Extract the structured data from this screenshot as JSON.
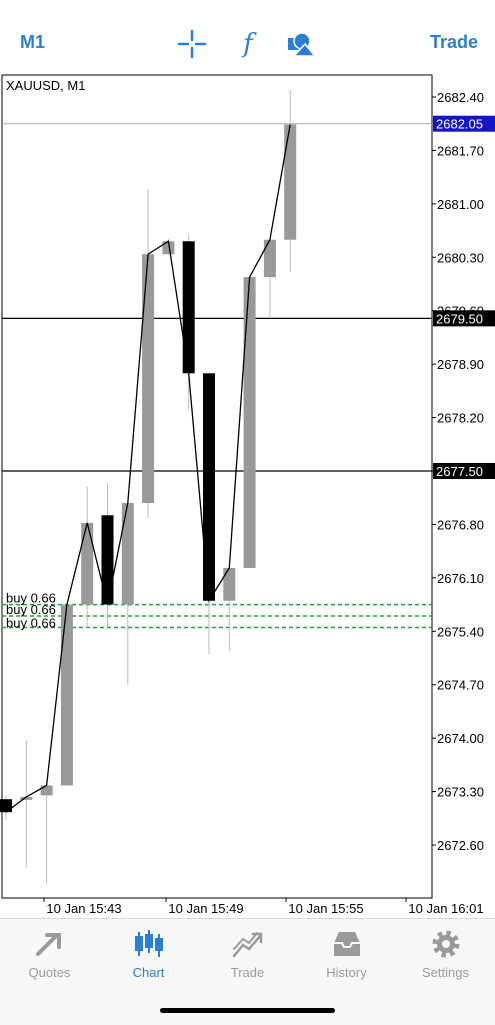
{
  "toolbar": {
    "timeframe": "M1",
    "trade_label": "Trade",
    "icons": [
      "crosshair-icon",
      "indicators-icon",
      "objects-icon"
    ],
    "accent_color": "#2a7fd4"
  },
  "chart_data": {
    "type": "candlestick",
    "symbol_label": "XAUUSD, M1",
    "price_ticks": [
      "2682.40",
      "2681.70",
      "2681.00",
      "2680.30",
      "2679.60",
      "2678.90",
      "2678.20",
      "2677.50",
      "2676.80",
      "2676.10",
      "2675.40",
      "2674.70",
      "2674.00",
      "2673.30",
      "2672.60"
    ],
    "time_ticks": [
      "10 Jan 15:43",
      "10 Jan 15:49",
      "10 Jan 15:55",
      "10 Jan 16:01"
    ],
    "ylim": [
      2671.9,
      2682.85
    ],
    "current_price": {
      "label": "2682.05",
      "value": 2682.05,
      "color": "#1515c8"
    },
    "horizontal_lines": [
      {
        "label": "2679.50",
        "value": 2679.5
      },
      {
        "label": "2677.50",
        "value": 2677.5
      }
    ],
    "orders": [
      {
        "label": "buy 0.66",
        "value": 2675.75,
        "color": "#2a9d3a"
      },
      {
        "label": "buy 0.66",
        "value": 2675.6,
        "color": "#2a9d3a"
      },
      {
        "label": "buy 0.66",
        "value": 2675.45,
        "color": "#2a9d3a"
      }
    ],
    "bull_color": "#999999",
    "bear_color": "#000000",
    "candles": [
      {
        "o": 2673.2,
        "h": 2673.25,
        "l": 2672.93,
        "c": 2673.03
      },
      {
        "o": 2673.2,
        "h": 2673.98,
        "l": 2672.3,
        "c": 2673.23
      },
      {
        "o": 2673.25,
        "h": 2673.3,
        "l": 2672.1,
        "c": 2673.38
      },
      {
        "o": 2673.38,
        "h": 2675.7,
        "l": 2673.38,
        "c": 2675.75
      },
      {
        "o": 2675.75,
        "h": 2677.3,
        "l": 2675.45,
        "c": 2676.82
      },
      {
        "o": 2676.92,
        "h": 2677.35,
        "l": 2675.45,
        "c": 2675.75
      },
      {
        "o": 2675.75,
        "h": 2677.08,
        "l": 2674.7,
        "c": 2677.08
      },
      {
        "o": 2677.08,
        "h": 2681.19,
        "l": 2676.88,
        "c": 2680.34
      },
      {
        "o": 2680.34,
        "h": 2680.54,
        "l": 2680.34,
        "c": 2680.51
      },
      {
        "o": 2680.51,
        "h": 2680.6,
        "l": 2678.29,
        "c": 2678.78
      },
      {
        "o": 2678.78,
        "h": 2678.78,
        "l": 2675.1,
        "c": 2675.8
      },
      {
        "o": 2675.8,
        "h": 2676.18,
        "l": 2675.14,
        "c": 2676.23
      },
      {
        "o": 2676.23,
        "h": 2680.04,
        "l": 2676.23,
        "c": 2680.04
      },
      {
        "o": 2680.04,
        "h": 2680.53,
        "l": 2679.5,
        "c": 2680.53
      },
      {
        "o": 2680.53,
        "h": 2682.5,
        "l": 2680.1,
        "c": 2682.04
      }
    ]
  },
  "tabs": [
    {
      "label": "Quotes",
      "icon": "quotes-icon"
    },
    {
      "label": "Chart",
      "icon": "chart-icon",
      "active": true
    },
    {
      "label": "Trade",
      "icon": "trade-icon"
    },
    {
      "label": "History",
      "icon": "history-icon"
    },
    {
      "label": "Settings",
      "icon": "settings-icon"
    }
  ]
}
